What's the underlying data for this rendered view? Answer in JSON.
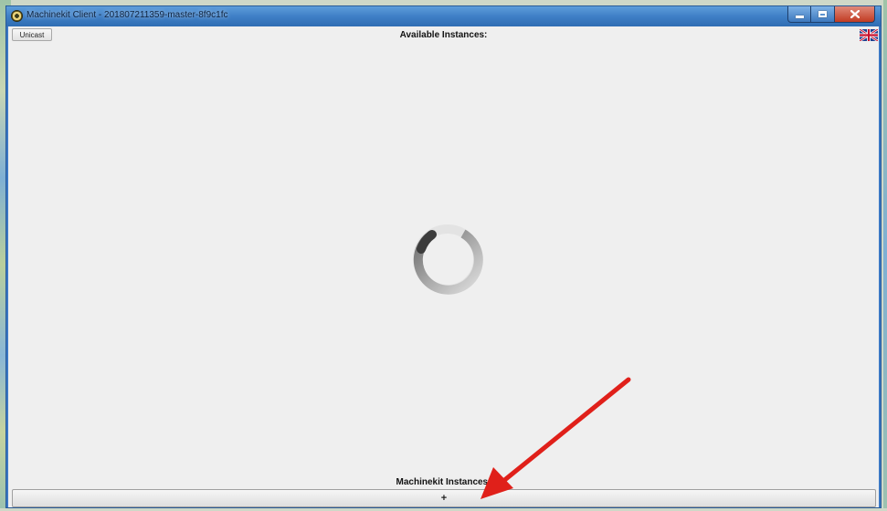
{
  "window": {
    "title": "Machinekit Client - 201807211359-master-8f9c1fc"
  },
  "toolbar": {
    "unicast_label": "Unicast",
    "flag_icon": "uk-flag-icon"
  },
  "main": {
    "header": "Available Instances:",
    "spinner_icon": "loading-spinner-icon"
  },
  "footer": {
    "title": "Machinekit Instances:",
    "add_label": "+"
  },
  "colors": {
    "titlebar": "#3f7fc6",
    "client_bg": "#efefef",
    "annotation_arrow": "#e0201a"
  }
}
